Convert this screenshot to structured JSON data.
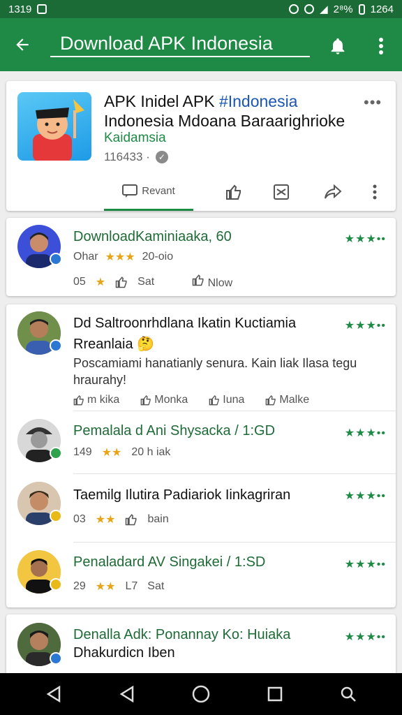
{
  "status_bar": {
    "time": "1319",
    "right_text": "2⁸%",
    "clock": "1264"
  },
  "header": {
    "title": "Download APK Indonesia"
  },
  "app": {
    "title_part1": "APK Inidel APK ",
    "title_hash": "#Indonesia",
    "subtitle": "Indonesia Mdoana Baraarighrioke",
    "developer": "Kaidamsia",
    "count": "116433 ·",
    "menu": "•••",
    "actions": {
      "relevant": "Revant"
    }
  },
  "reviews": [
    {
      "name": "DownloadKaminiaaka, 60",
      "meta_prefix": "Ohar",
      "meta_stars": "★★★",
      "meta_time": "20-oio",
      "line2_num": "05",
      "line2_star": "★",
      "line2_like": "Sat",
      "line2_now": "Nlow"
    },
    {
      "name": "Dd Saltroonrhdlana Ikatin Kuctiamia",
      "name2": "Rreanlaia 🤔",
      "body": "Poscamiami hanatianly senura. Kain liak Ilasa tegu hraurahy!",
      "actions": [
        "m kika",
        "Monka",
        "Iuna",
        "Malke"
      ]
    },
    {
      "name": "Pemalala d Ani Shysacka / 1:GD",
      "meta_num": "149",
      "meta_stars": "★★",
      "meta_time": "20 h iak"
    },
    {
      "name": "Taemilg Ilutira Padiariok Iinkagriran",
      "meta_num": "03",
      "meta_stars": "★★",
      "meta_like": "bain"
    },
    {
      "name": "Penaladard AV Singakei / 1:SD",
      "meta_num": "29",
      "meta_stars": "★★",
      "meta_time": "L7",
      "meta_like": "Sat"
    },
    {
      "name": "Denalla Adk: Ponannay Ko: Huiaka",
      "name2": "Dhakurdicn Iben"
    }
  ],
  "review_stars": "★★★••",
  "colors": {
    "primary": "#1e8a45",
    "status": "#1b6b37",
    "accent_gold": "#e8a317"
  }
}
